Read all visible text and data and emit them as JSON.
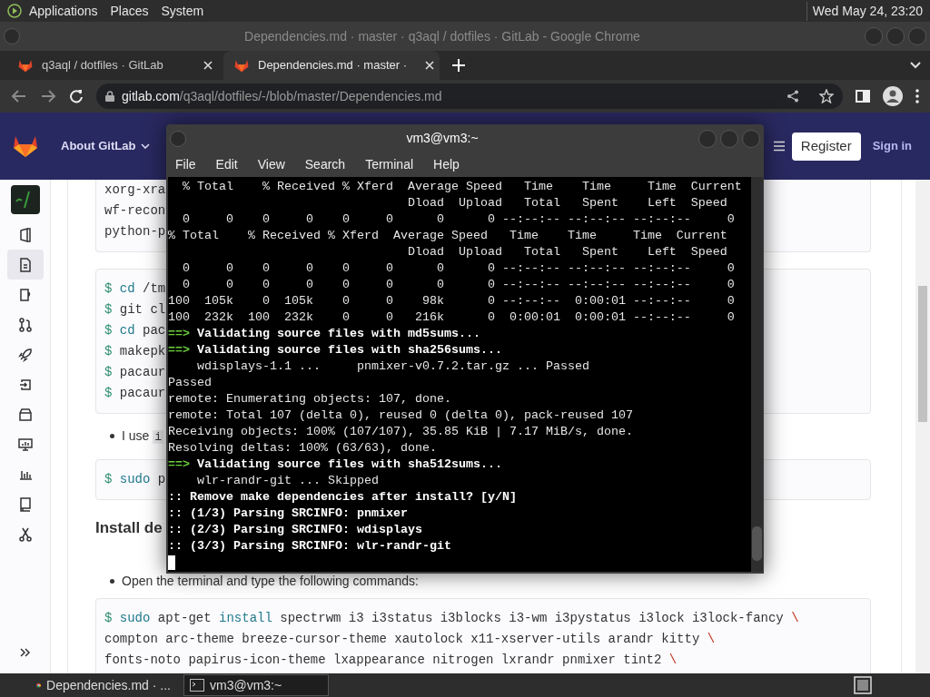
{
  "top_panel": {
    "menus": [
      "Applications",
      "Places",
      "System"
    ],
    "clock": "Wed May 24, 23:20"
  },
  "browser": {
    "title": "Dependencies.md · master · q3aql / dotfiles · GitLab - Google Chrome",
    "tabs": [
      {
        "label": "q3aql / dotfiles · GitLab",
        "selected": false
      },
      {
        "label": "Dependencies.md · master ·",
        "selected": true
      }
    ],
    "url": {
      "host": "gitlab.com",
      "path": "/q3aql/dotfiles/-/blob/master/Dependencies.md"
    }
  },
  "gitlab": {
    "nav": {
      "about": "About GitLab",
      "register": "Register",
      "sign_in": "Sign in"
    },
    "sidebar": [
      {
        "kind": "project",
        "selected": false
      },
      {
        "kind": "overview",
        "selected": false
      },
      {
        "kind": "repository",
        "selected": true
      },
      {
        "kind": "issues",
        "selected": false
      },
      {
        "kind": "merge",
        "selected": false
      },
      {
        "kind": "cicd",
        "selected": false
      },
      {
        "kind": "deploy",
        "selected": false
      },
      {
        "kind": "packages",
        "selected": false
      },
      {
        "kind": "monitor",
        "selected": false
      },
      {
        "kind": "analytics",
        "selected": false
      },
      {
        "kind": "wiki",
        "selected": false
      },
      {
        "kind": "snippets",
        "selected": false
      }
    ],
    "content": [
      {
        "kind": "code",
        "cut_top": true,
        "lines": [
          [
            {
              "kind": "plain",
              "text": "xorg-xra"
            }
          ],
          [
            {
              "kind": "plain",
              "text": "wf-recon"
            }
          ],
          [
            {
              "kind": "plain",
              "text": "python-p"
            }
          ]
        ]
      },
      {
        "kind": "code",
        "cut_top": false,
        "lines": [
          [
            {
              "kind": "prompt",
              "text": "$"
            },
            {
              "kind": "keyword",
              "text": " cd"
            },
            {
              "kind": "plain",
              "text": " /tm"
            }
          ],
          [
            {
              "kind": "prompt",
              "text": "$"
            },
            {
              "kind": "plain",
              "text": " git cl"
            }
          ],
          [
            {
              "kind": "prompt",
              "text": "$"
            },
            {
              "kind": "keyword",
              "text": " cd"
            },
            {
              "kind": "plain",
              "text": " pac"
            }
          ],
          [
            {
              "kind": "prompt",
              "text": "$"
            },
            {
              "kind": "plain",
              "text": " makepk"
            }
          ],
          [
            {
              "kind": "prompt",
              "text": "$"
            },
            {
              "kind": "plain",
              "text": " pacaur"
            }
          ],
          [
            {
              "kind": "prompt",
              "text": "$"
            },
            {
              "kind": "plain",
              "text": " pacaur"
            }
          ]
        ]
      },
      {
        "kind": "bullet",
        "text": "I use",
        "code": "i"
      },
      {
        "kind": "code",
        "cut_top": false,
        "lines": [
          [
            {
              "kind": "prompt",
              "text": "$"
            },
            {
              "kind": "keyword",
              "text": " sudo"
            },
            {
              "kind": "plain",
              "text": " p"
            }
          ]
        ]
      },
      {
        "kind": "heading",
        "text": "Install de"
      },
      {
        "kind": "bullet",
        "text": "Open the terminal and type the following commands:"
      },
      {
        "kind": "code",
        "cut_top": false,
        "lines": [
          [
            {
              "kind": "prompt",
              "text": "$"
            },
            {
              "kind": "keyword",
              "text": " sudo"
            },
            {
              "kind": "plain",
              "text": " apt-get "
            },
            {
              "kind": "keyword",
              "text": "install"
            },
            {
              "kind": "plain",
              "text": " spectrwm i3 i3status i3blocks i3-wm i3pystatus i3lock i3lock-fancy "
            },
            {
              "kind": "escape",
              "text": "\\"
            }
          ],
          [
            {
              "kind": "plain",
              "text": "compton arc-theme breeze-cursor-theme xautolock x11-xserver-utils arandr kitty "
            },
            {
              "kind": "escape",
              "text": "\\"
            }
          ],
          [
            {
              "kind": "plain",
              "text": "fonts-noto papirus-icon-theme lxappearance nitrogen lxrandr pnmixer tint2 "
            },
            {
              "kind": "escape",
              "text": "\\"
            }
          ]
        ]
      }
    ]
  },
  "terminal": {
    "title": "vm3@vm3:~",
    "menu": [
      "File",
      "Edit",
      "View",
      "Search",
      "Terminal",
      "Help"
    ],
    "lines": [
      {
        "kind": "plain",
        "text": "  % Total    % Received % Xferd  Average Speed   Time    Time     Time  Current"
      },
      {
        "kind": "plain",
        "text": "                                 Dload  Upload   Total   Spent    Left  Speed"
      },
      {
        "kind": "plain",
        "text": "  0     0    0     0    0     0      0      0 --:--:-- --:--:-- --:--:--     0"
      },
      {
        "kind": "plain",
        "text": "% Total    % Received % Xferd  Average Speed   Time    Time     Time  Current"
      },
      {
        "kind": "plain",
        "text": "                                 Dload  Upload   Total   Spent    Left  Speed"
      },
      {
        "kind": "plain",
        "text": "  0     0    0     0    0     0      0      0 --:--:-- --:--:-- --:--:--     0"
      },
      {
        "kind": "plain",
        "text": "  0     0    0     0    0     0      0      0 --:--:-- --:--:-- --:--:--     0"
      },
      {
        "kind": "plain",
        "text": "100  105k    0  105k    0     0    98k      0 --:--:--  0:00:01 --:--:--     0"
      },
      {
        "kind": "plain",
        "text": "100  232k  100  232k    0     0   216k      0  0:00:01  0:00:01 --:--:--     0"
      },
      {
        "kind": "step",
        "marker": "==>",
        "text": " Validating source files with md5sums..."
      },
      {
        "kind": "step",
        "marker": "==>",
        "text": " Validating source files with sha256sums..."
      },
      {
        "kind": "plain",
        "text": "    wdisplays-1.1 ...     pnmixer-v0.7.2.tar.gz ... Passed"
      },
      {
        "kind": "plain",
        "text": "Passed"
      },
      {
        "kind": "plain",
        "text": "remote: Enumerating objects: 107, done."
      },
      {
        "kind": "plain",
        "text": "remote: Total 107 (delta 0), reused 0 (delta 0), pack-reused 107"
      },
      {
        "kind": "plain",
        "text": "Receiving objects: 100% (107/107), 35.85 KiB | 7.17 MiB/s, done."
      },
      {
        "kind": "plain",
        "text": "Resolving deltas: 100% (63/63), done."
      },
      {
        "kind": "step",
        "marker": "==>",
        "text": " Validating source files with sha512sums..."
      },
      {
        "kind": "plain",
        "text": "    wlr-randr-git ... Skipped"
      },
      {
        "kind": "bold",
        "text": ":: Remove make dependencies after install? [y/N]"
      },
      {
        "kind": "bold",
        "text": ":: (1/3) Parsing SRCINFO: pnmixer"
      },
      {
        "kind": "bold",
        "text": ":: (2/3) Parsing SRCINFO: wdisplays"
      },
      {
        "kind": "bold",
        "text": ":: (3/3) Parsing SRCINFO: wlr-randr-git"
      }
    ]
  },
  "taskbar": [
    {
      "kind": "browser",
      "label": "Dependencies.md · ...",
      "selected": false
    },
    {
      "kind": "terminal",
      "label": "vm3@vm3:~",
      "selected": true
    }
  ]
}
